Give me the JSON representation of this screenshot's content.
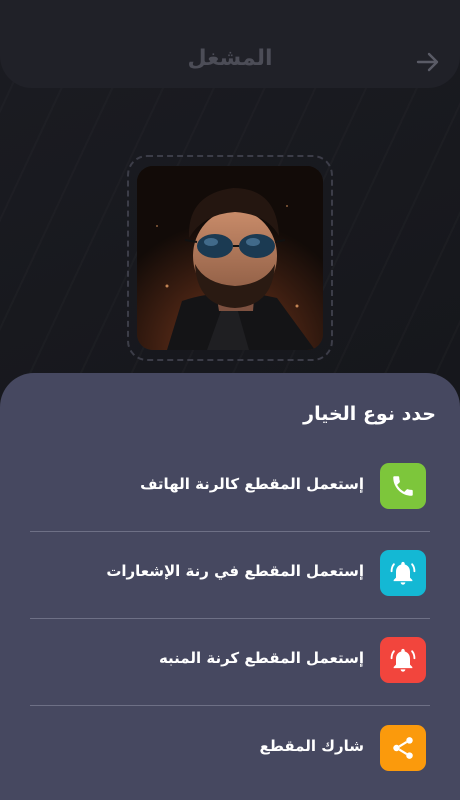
{
  "header": {
    "title": "المشغل"
  },
  "sheet": {
    "title": "حدد نوع الخيار",
    "options": [
      {
        "label": "إستعمل المقطع كالرنة الهاتف",
        "icon": "phone-icon",
        "color": "#7dc63b"
      },
      {
        "label": "إستعمل المقطع في رنة الإشعارات",
        "icon": "bell-icon",
        "color": "#14b8d4"
      },
      {
        "label": "إستعمل المقطع كرنة المنبه",
        "icon": "alarm-icon",
        "color": "#f2453d"
      },
      {
        "label": "شارك المقطع",
        "icon": "share-icon",
        "color": "#fb9a0c"
      }
    ]
  },
  "colors": {
    "background": "#15161b",
    "header": "#202128",
    "sheet": "#464860",
    "divider": "#6e7086"
  }
}
